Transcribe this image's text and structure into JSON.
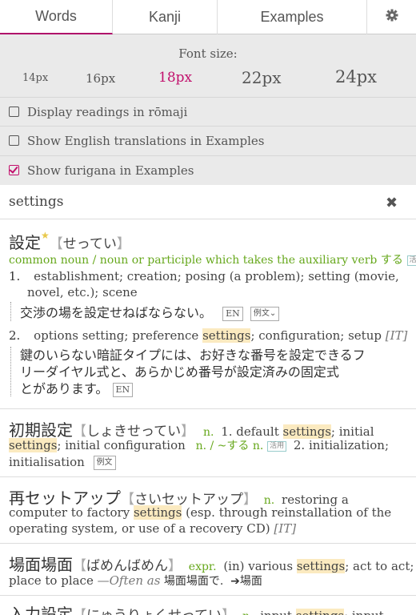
{
  "tabs": [
    {
      "label": "Words"
    },
    {
      "label": "Kanji"
    },
    {
      "label": "Examples"
    }
  ],
  "settings": {
    "font_size_label": "Font size:",
    "font_sizes": [
      "14px",
      "16px",
      "18px",
      "22px",
      "24px"
    ],
    "selected_font_size": "18px",
    "options": [
      {
        "label": "Display readings in rōmaji",
        "checked": false
      },
      {
        "label": "Show English translations in Examples",
        "checked": false
      },
      {
        "label": "Show furigana in Examples",
        "checked": true
      }
    ]
  },
  "search": {
    "value": "settings"
  },
  "results": [
    {
      "word": "設定",
      "reading": "せってい",
      "pos": "common noun / noun or participle which takes the auxiliary verb する",
      "pos_tag": "活用",
      "senses": [
        {
          "num": "1.",
          "line1": "establishment; creation; posing (a problem); setting (movie,",
          "line2": "novel, etc.); scene",
          "example": "交渉の場を設定せねばならない。",
          "en_btn": "EN",
          "ex_btn": "例文"
        },
        {
          "num": "2.",
          "pre": "options setting; preference ",
          "hl": "settings",
          "post": "; configuration; setup ",
          "field": "[IT]",
          "example_lines": [
            "鍵のいらない暗証タイプには、お好きな番号を設定できるフ",
            "リーダイヤル式と、あらかじめ番号が設定済みの固定式",
            "とがあります。"
          ],
          "en_btn": "EN"
        }
      ]
    },
    {
      "word": "初期設定",
      "reading": "しょきせってい",
      "pos1": "n.",
      "s1_pre": "1. default ",
      "s1_hl": "settings",
      "s1_post": "; initial",
      "s1_hl2": "settings",
      "s1_post2": "; initial configuration",
      "pos2": "n. / ~する n.",
      "pos2_tag": "活用",
      "s2": "2. initialization;",
      "s2_line2": "initialisation",
      "ex_btn": "例文"
    },
    {
      "word": "再セットアップ",
      "reading": "さいセットアップ",
      "pos": "n.",
      "d1": "restoring a",
      "d2_pre": "computer to factory ",
      "d2_hl": "settings",
      "d2_post": " (esp. through reinstallation of the",
      "d3": "operating system, or use of a recovery CD) ",
      "d3_field": "[IT]"
    },
    {
      "word": "場面場面",
      "reading": "ばめんばめん",
      "pos": "expr.",
      "d1_pre": "(in) various ",
      "d1_hl": "settings",
      "d1_post": "; act to act;",
      "d2_pre": "place to place ",
      "d2_italic": "—Often as",
      "d2_ja": " 場面場面で.",
      "d2_ref": "➔場面"
    },
    {
      "word": "入力設定",
      "reading": "にゅうりょくせってい",
      "pos": "n.",
      "d1_pre": "input ",
      "d1_hl": "settings",
      "d1_post": "; input"
    }
  ],
  "colors": {
    "accent": "#c2106d",
    "pos_green": "#67a81d",
    "highlight": "#fbeac0",
    "panel_bg": "#eaeaea"
  },
  "icons": {
    "settings": "gear-icon",
    "clear": "close-icon",
    "common": "star-icon"
  }
}
